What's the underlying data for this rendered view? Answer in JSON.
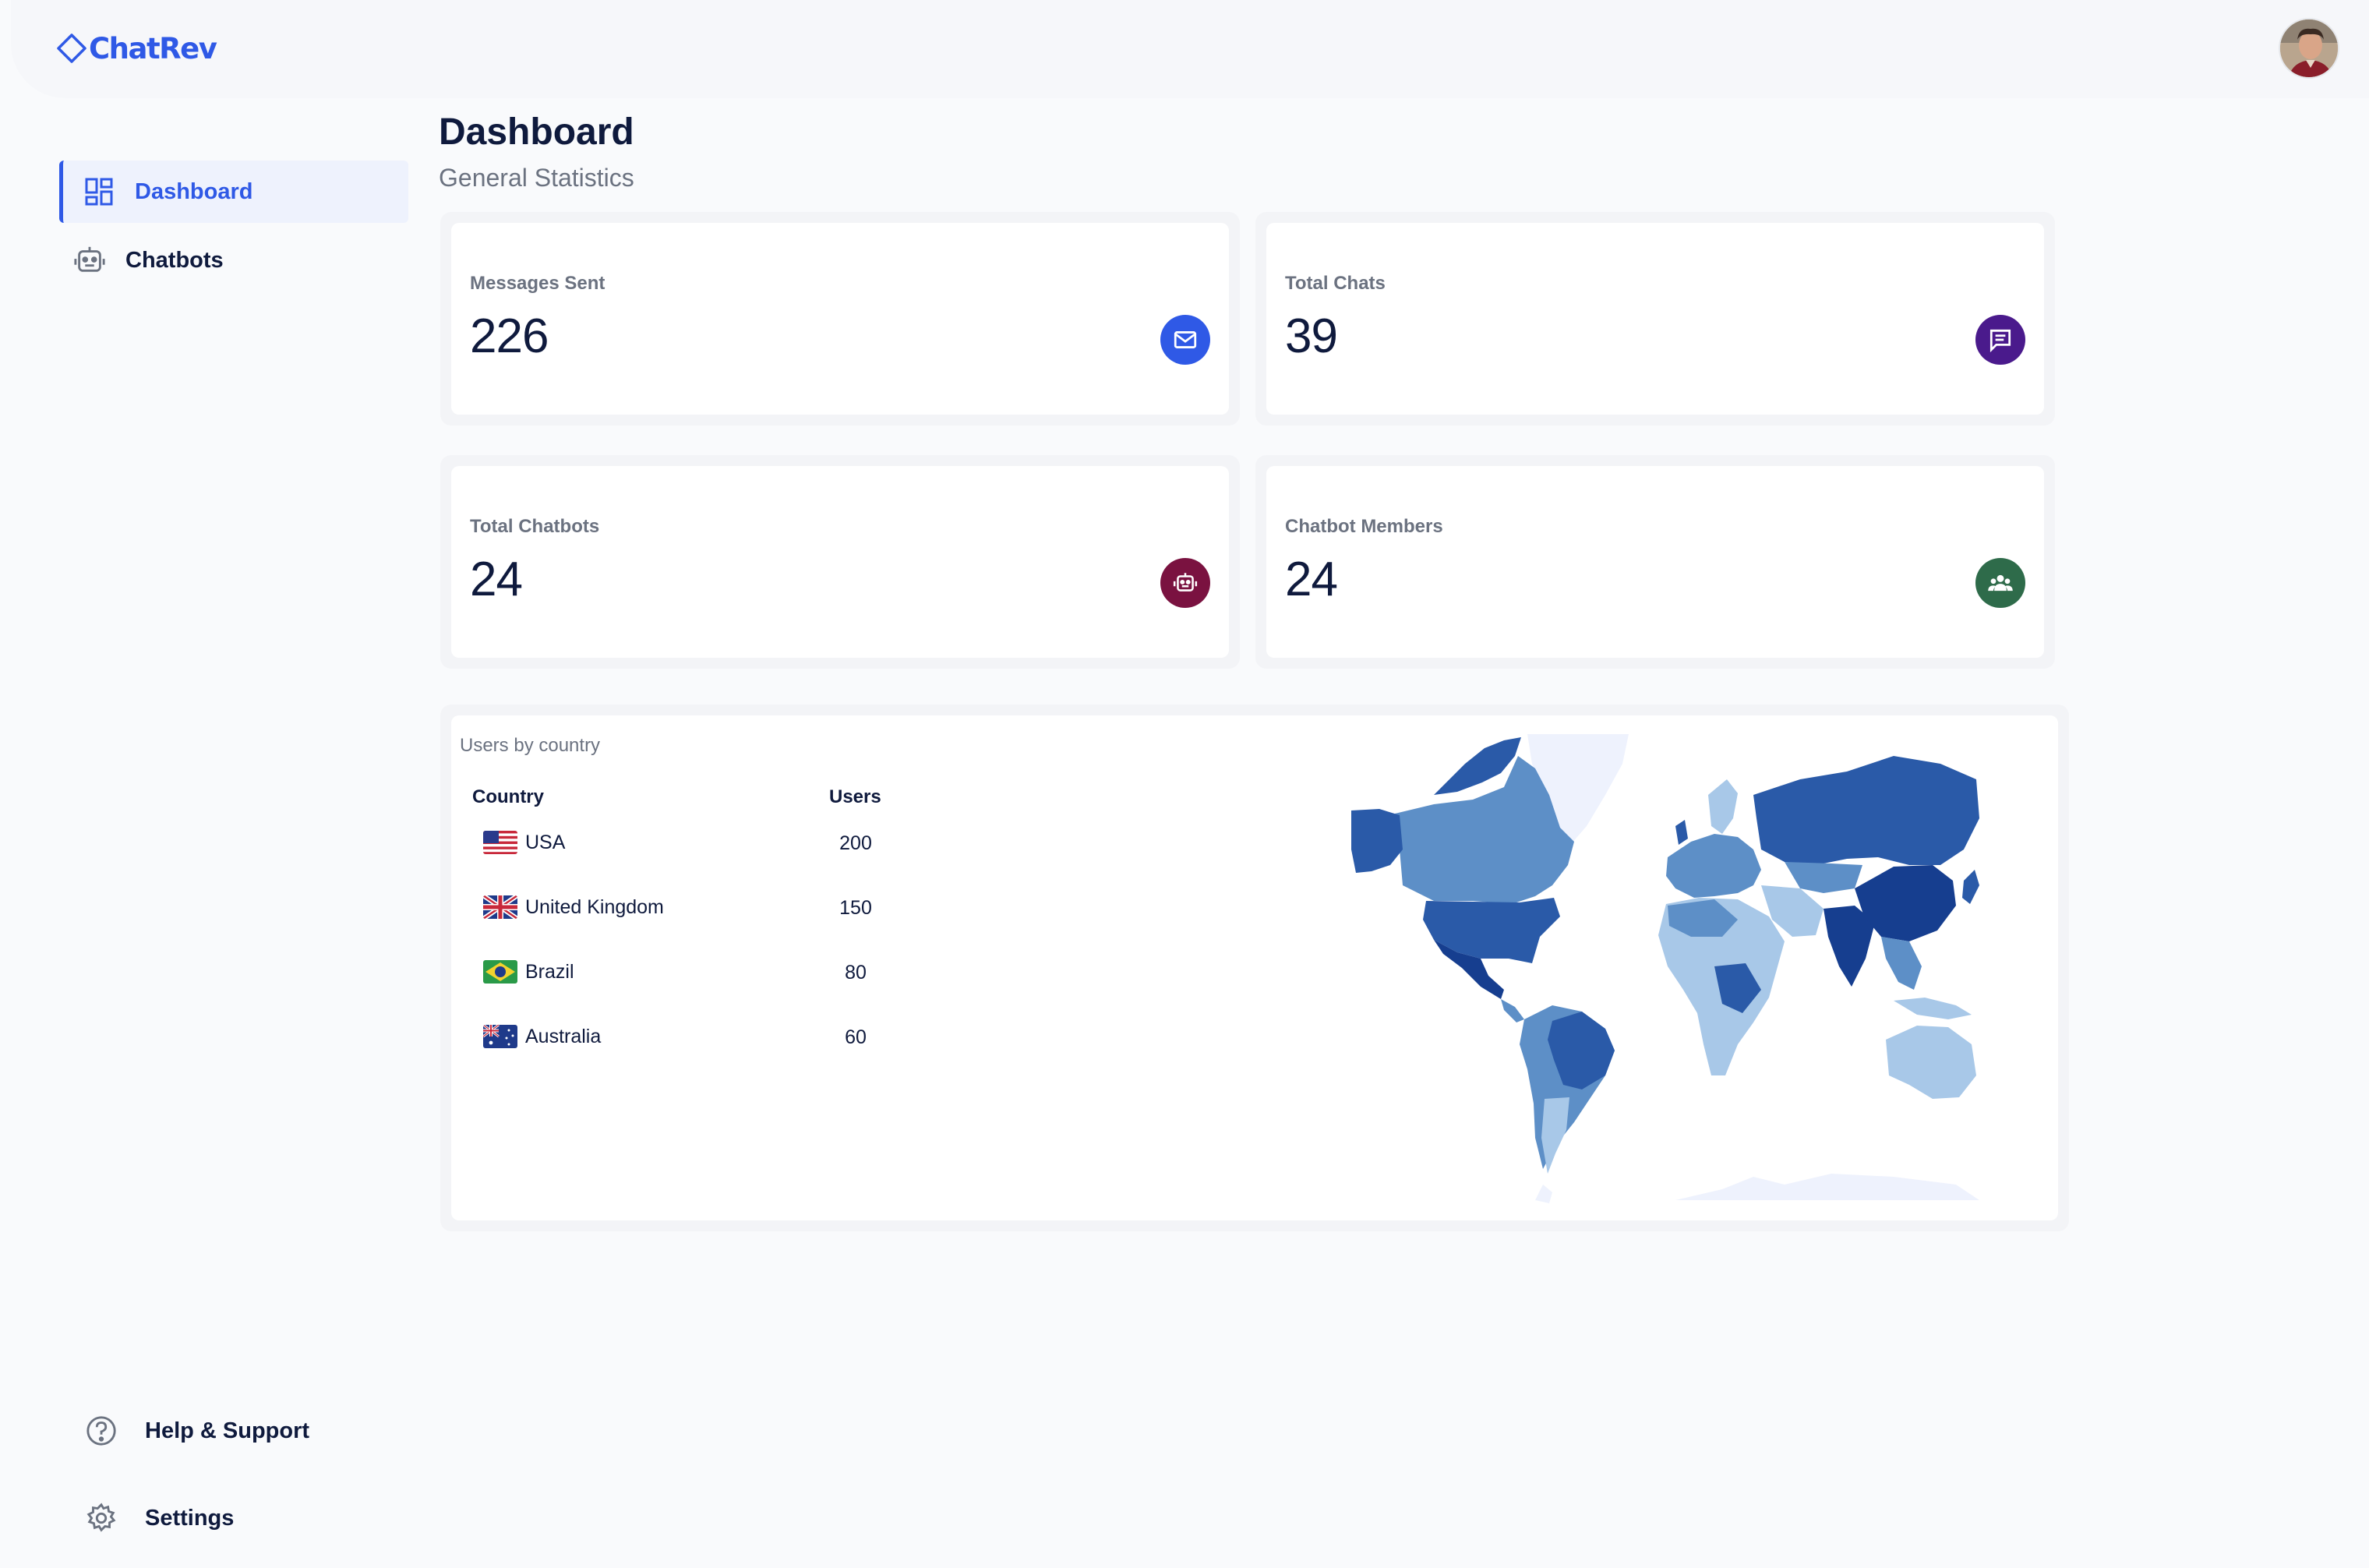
{
  "app": {
    "name": "ChatRev"
  },
  "sidebar": {
    "items": [
      {
        "label": "Dashboard",
        "icon": "dashboard-icon",
        "active": true
      },
      {
        "label": "Chatbots",
        "icon": "robot-icon",
        "active": false
      }
    ],
    "footer": [
      {
        "label": "Help & Support",
        "icon": "help-icon"
      },
      {
        "label": "Settings",
        "icon": "gear-icon"
      }
    ]
  },
  "header": {
    "title": "Dashboard",
    "subtitle": "General Statistics"
  },
  "stats": [
    {
      "label": "Messages Sent",
      "value": "226",
      "icon": "mail-icon",
      "color": "#2f59e6"
    },
    {
      "label": "Total Chats",
      "value": "39",
      "icon": "chat-icon",
      "color": "#4a1a8c"
    },
    {
      "label": "Total Chatbots",
      "value": "24",
      "icon": "robot-icon",
      "color": "#7a1240"
    },
    {
      "label": "Chatbot Members",
      "value": "24",
      "icon": "group-icon",
      "color": "#2e6b4a"
    }
  ],
  "countries": {
    "title": "Users by country",
    "headers": {
      "country": "Country",
      "users": "Users"
    },
    "rows": [
      {
        "country": "USA",
        "users": "200",
        "flag": "us-flag"
      },
      {
        "country": "United Kingdom",
        "users": "150",
        "flag": "uk-flag"
      },
      {
        "country": "Brazil",
        "users": "80",
        "flag": "brazil-flag"
      },
      {
        "country": "Australia",
        "users": "60",
        "flag": "australia-flag"
      }
    ],
    "map_colors": {
      "light": "#a8c8e8",
      "mid": "#5d8fc7",
      "dark": "#2a5aa8",
      "darkest": "#163e8f",
      "ice": "#eef2fd"
    }
  }
}
